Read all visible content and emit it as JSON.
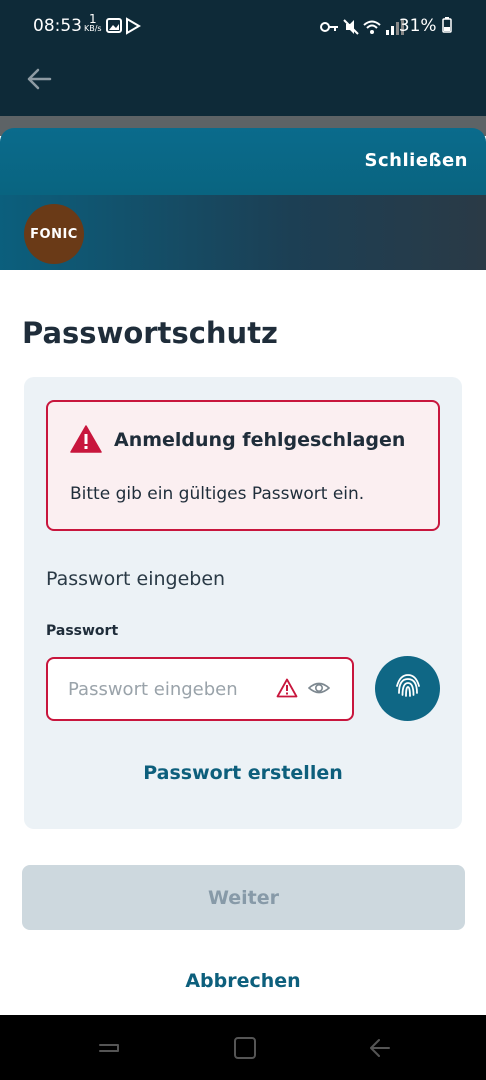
{
  "status_bar": {
    "time": "08:53",
    "kb_num": "1",
    "kb_unit": "KB/s",
    "battery": "31%"
  },
  "header": {
    "close_label": "Schließen",
    "logo_text": "FONIC"
  },
  "page_title": "Passwortschutz",
  "alert": {
    "title": "Anmeldung fehlgeschlagen",
    "message": "Bitte gib ein gültiges Passwort ein."
  },
  "form": {
    "section_label": "Passwort eingeben",
    "field_label": "Passwort",
    "password_placeholder": "Passwort eingeben",
    "password_value": "",
    "create_password_link": "Passwort erstellen"
  },
  "actions": {
    "continue_label": "Weiter",
    "cancel_label": "Abbrechen"
  },
  "colors": {
    "error": "#c8163d",
    "accent": "#0d5f7c",
    "fingerprint_button": "#0f6785",
    "disabled_button": "#cdd8de"
  },
  "icons": [
    "back-arrow-icon",
    "warning-icon",
    "eye-icon",
    "fingerprint-icon"
  ]
}
